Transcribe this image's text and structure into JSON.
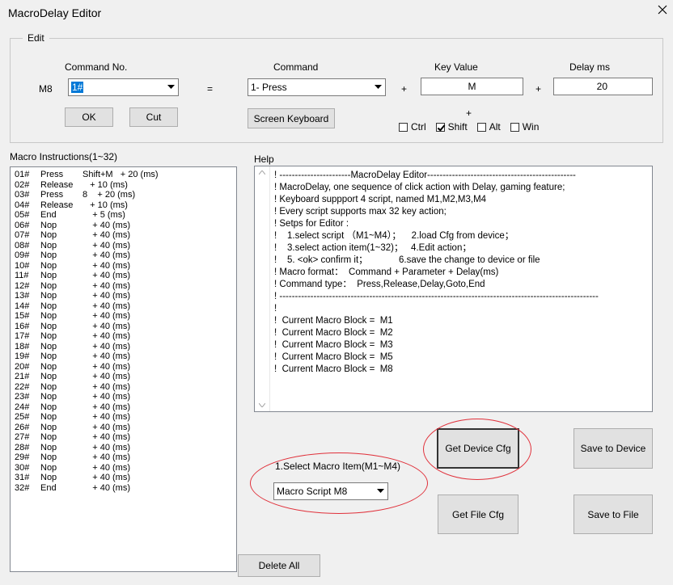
{
  "window": {
    "title": "MacroDelay Editor"
  },
  "edit": {
    "group_label": "Edit",
    "row_label": "M8",
    "command_no": {
      "label": "Command No.",
      "value": "1#"
    },
    "equals": "=",
    "command": {
      "label": "Command",
      "value": "1- Press"
    },
    "plus1": "+",
    "key_value": {
      "label": "Key Value",
      "value": "M"
    },
    "plus2": "+",
    "delay": {
      "label": "Delay ms",
      "value": "20"
    },
    "ok_label": "OK",
    "cut_label": "Cut",
    "screen_keyboard_label": "Screen Keyboard",
    "plus_mod": "+",
    "modifiers": [
      {
        "label": "Ctrl",
        "checked": false
      },
      {
        "label": "Shift",
        "checked": true
      },
      {
        "label": "Alt",
        "checked": false
      },
      {
        "label": "Win",
        "checked": false
      }
    ]
  },
  "macro_list": {
    "label": "Macro Instructions(1~32)",
    "rows": [
      [
        "01#",
        "Press",
        "Shift+M   + 20 (ms)"
      ],
      [
        "02#",
        "Release",
        "   + 10 (ms)"
      ],
      [
        "03#",
        "Press",
        "8    + 20 (ms)"
      ],
      [
        "04#",
        "Release",
        "   + 10 (ms)"
      ],
      [
        "05#",
        "End",
        "    + 5 (ms)"
      ],
      [
        "06#",
        "Nop",
        "    + 40 (ms)"
      ],
      [
        "07#",
        "Nop",
        "    + 40 (ms)"
      ],
      [
        "08#",
        "Nop",
        "    + 40 (ms)"
      ],
      [
        "09#",
        "Nop",
        "    + 40 (ms)"
      ],
      [
        "10#",
        "Nop",
        "    + 40 (ms)"
      ],
      [
        "11#",
        "Nop",
        "    + 40 (ms)"
      ],
      [
        "12#",
        "Nop",
        "    + 40 (ms)"
      ],
      [
        "13#",
        "Nop",
        "    + 40 (ms)"
      ],
      [
        "14#",
        "Nop",
        "    + 40 (ms)"
      ],
      [
        "15#",
        "Nop",
        "    + 40 (ms)"
      ],
      [
        "16#",
        "Nop",
        "    + 40 (ms)"
      ],
      [
        "17#",
        "Nop",
        "    + 40 (ms)"
      ],
      [
        "18#",
        "Nop",
        "    + 40 (ms)"
      ],
      [
        "19#",
        "Nop",
        "    + 40 (ms)"
      ],
      [
        "20#",
        "Nop",
        "    + 40 (ms)"
      ],
      [
        "21#",
        "Nop",
        "    + 40 (ms)"
      ],
      [
        "22#",
        "Nop",
        "    + 40 (ms)"
      ],
      [
        "23#",
        "Nop",
        "    + 40 (ms)"
      ],
      [
        "24#",
        "Nop",
        "    + 40 (ms)"
      ],
      [
        "25#",
        "Nop",
        "    + 40 (ms)"
      ],
      [
        "26#",
        "Nop",
        "    + 40 (ms)"
      ],
      [
        "27#",
        "Nop",
        "    + 40 (ms)"
      ],
      [
        "28#",
        "Nop",
        "    + 40 (ms)"
      ],
      [
        "29#",
        "Nop",
        "    + 40 (ms)"
      ],
      [
        "30#",
        "Nop",
        "    + 40 (ms)"
      ],
      [
        "31#",
        "Nop",
        "    + 40 (ms)"
      ],
      [
        "32#",
        "End",
        "    + 40 (ms)"
      ]
    ]
  },
  "help": {
    "label": "Help",
    "lines": [
      "! -----------------------MacroDelay Editor------------------------------------------------",
      "! MacroDelay, one sequence of click action with Delay, gaming feature;",
      "! Keyboard suppport 4 script, named M1,M2,M3,M4",
      "! Every script supports max 32 key action;",
      "! Setps for Editor :",
      "!    1.select script （M1~M4）；    2.load Cfg from device；",
      "!    3.select action item(1~32)；   4.Edit action；",
      "!    5. <ok> confirm it；            6.save the change to device or file",
      "! Macro format：  Command + Parameter + Delay(ms)",
      "! Command type：  Press,Release,Delay,Goto,End",
      "! -------------------------------------------------------------------------------------------------------",
      "!",
      "!  Current Macro Block =  M1",
      "!  Current Macro Block =  M2",
      "!  Current Macro Block =  M3",
      "!  Current Macro Block =  M5",
      "!  Current Macro Block =  M8"
    ]
  },
  "select_macro": {
    "label": "1.Select Macro Item(M1~M4)",
    "value": "Macro Script M8"
  },
  "buttons": {
    "get_device_cfg": "Get Device Cfg",
    "save_to_device": "Save to Device",
    "get_file_cfg": "Get File Cfg",
    "save_to_file": "Save to File",
    "delete_all": "Delete All"
  }
}
